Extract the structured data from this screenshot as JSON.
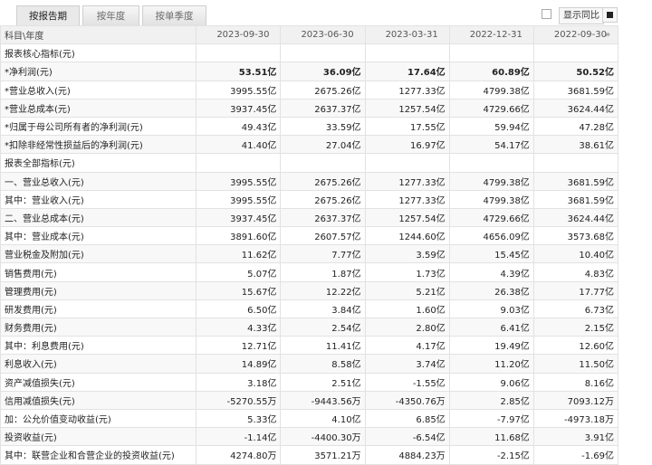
{
  "tabs": [
    {
      "label": "按报告期"
    },
    {
      "label": "按年度"
    },
    {
      "label": "按单季度"
    }
  ],
  "toolbar": {
    "yoy_label": "显示同比"
  },
  "table": {
    "header_label": "科目\\年度",
    "periods": [
      "2023-09-30",
      "2023-06-30",
      "2023-03-31",
      "2022-12-31",
      "2022-09-30"
    ],
    "more_symbol": "»",
    "rows": [
      {
        "type": "section",
        "label": "报表核心指标(元)"
      },
      {
        "type": "bold",
        "label": "*净利润(元)",
        "values": [
          "53.51亿",
          "36.09亿",
          "17.64亿",
          "60.89亿",
          "50.52亿"
        ]
      },
      {
        "label": "*营业总收入(元)",
        "values": [
          "3995.55亿",
          "2675.26亿",
          "1277.33亿",
          "4799.38亿",
          "3681.59亿"
        ]
      },
      {
        "label": "*营业总成本(元)",
        "values": [
          "3937.45亿",
          "2637.37亿",
          "1257.54亿",
          "4729.66亿",
          "3624.44亿"
        ]
      },
      {
        "label": "*归属于母公司所有者的净利润(元)",
        "values": [
          "49.43亿",
          "33.59亿",
          "17.55亿",
          "59.94亿",
          "47.28亿"
        ]
      },
      {
        "label": "*扣除非经常性损益后的净利润(元)",
        "values": [
          "41.40亿",
          "27.04亿",
          "16.97亿",
          "54.17亿",
          "38.61亿"
        ]
      },
      {
        "type": "section",
        "label": "报表全部指标(元)"
      },
      {
        "label": "一、营业总收入(元)",
        "values": [
          "3995.55亿",
          "2675.26亿",
          "1277.33亿",
          "4799.38亿",
          "3681.59亿"
        ]
      },
      {
        "label": "其中：营业收入(元)",
        "values": [
          "3995.55亿",
          "2675.26亿",
          "1277.33亿",
          "4799.38亿",
          "3681.59亿"
        ]
      },
      {
        "label": "二、营业总成本(元)",
        "values": [
          "3937.45亿",
          "2637.37亿",
          "1257.54亿",
          "4729.66亿",
          "3624.44亿"
        ]
      },
      {
        "label": "其中：营业成本(元)",
        "values": [
          "3891.60亿",
          "2607.57亿",
          "1244.60亿",
          "4656.09亿",
          "3573.68亿"
        ]
      },
      {
        "label": "营业税金及附加(元)",
        "values": [
          "11.62亿",
          "7.77亿",
          "3.59亿",
          "15.45亿",
          "10.40亿"
        ]
      },
      {
        "label": "销售费用(元)",
        "values": [
          "5.07亿",
          "1.87亿",
          "1.73亿",
          "4.39亿",
          "4.83亿"
        ]
      },
      {
        "label": "管理费用(元)",
        "values": [
          "15.67亿",
          "12.22亿",
          "5.21亿",
          "26.38亿",
          "17.77亿"
        ]
      },
      {
        "label": "研发费用(元)",
        "values": [
          "6.50亿",
          "3.84亿",
          "1.60亿",
          "9.03亿",
          "6.73亿"
        ]
      },
      {
        "label": "财务费用(元)",
        "values": [
          "4.33亿",
          "2.54亿",
          "2.80亿",
          "6.41亿",
          "2.15亿"
        ]
      },
      {
        "label": "其中：利息费用(元)",
        "values": [
          "12.71亿",
          "11.41亿",
          "4.17亿",
          "19.49亿",
          "12.60亿"
        ]
      },
      {
        "label": "利息收入(元)",
        "values": [
          "14.89亿",
          "8.58亿",
          "3.74亿",
          "11.20亿",
          "11.50亿"
        ]
      },
      {
        "label": "资产减值损失(元)",
        "values": [
          "3.18亿",
          "2.51亿",
          "-1.55亿",
          "9.06亿",
          "8.16亿"
        ]
      },
      {
        "label": "信用减值损失(元)",
        "values": [
          "-5270.55万",
          "-9443.56万",
          "-4350.76万",
          "2.85亿",
          "7093.12万"
        ]
      },
      {
        "label": "加：公允价值变动收益(元)",
        "values": [
          "5.33亿",
          "4.10亿",
          "6.85亿",
          "-7.97亿",
          "-4973.18万"
        ]
      },
      {
        "label": "投资收益(元)",
        "values": [
          "-1.14亿",
          "-4400.30万",
          "-6.54亿",
          "11.68亿",
          "3.91亿"
        ]
      },
      {
        "label": "其中：联营企业和合营企业的投资收益(元)",
        "values": [
          "4274.80万",
          "3571.21万",
          "4884.23万",
          "-2.15亿",
          "-1.69亿"
        ]
      }
    ]
  }
}
